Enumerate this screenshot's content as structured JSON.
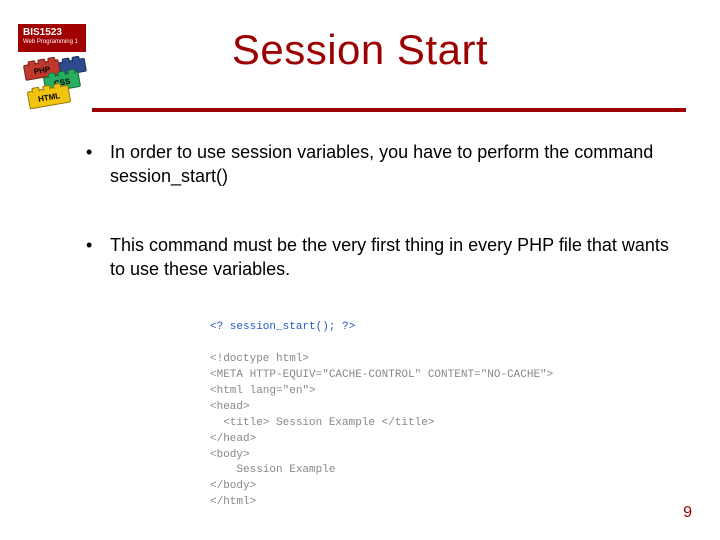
{
  "course": {
    "code": "BIS1523",
    "subtitle": "Web Programming 1"
  },
  "bricks": {
    "php": "PHP",
    "css": "CSS",
    "html": "HTML"
  },
  "title": "Session Start",
  "bullets": [
    "In order to use session variables, you have to perform the command session_start()",
    "This command must be the very first thing in every PHP file that wants to use these variables."
  ],
  "code": {
    "l1": "<? session_start(); ?>",
    "l2": "",
    "l3": "<!doctype html>",
    "l4": "<META HTTP-EQUIV=\"CACHE-CONTROL\" CONTENT=\"NO-CACHE\">",
    "l5": "<html lang=\"en\">",
    "l6": "<head>",
    "l7": "  <title> Session Example </title>",
    "l8": "</head>",
    "l9": "<body>",
    "l10": "    Session Example",
    "l11": "</body>",
    "l12": "</html>"
  },
  "page_number": "9"
}
